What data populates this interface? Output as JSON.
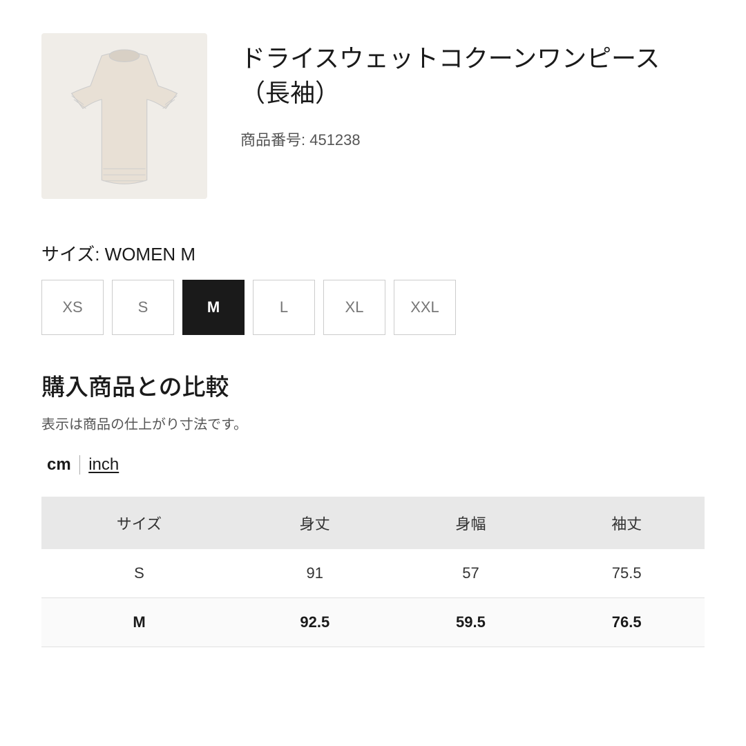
{
  "product": {
    "name": "ドライスウェットコクーンワンピース（長袖）",
    "number_label": "商品番号: 451238",
    "image_alt": "cream cocoon dress"
  },
  "size_section": {
    "label": "サイズ: WOMEN M",
    "sizes": [
      "XS",
      "S",
      "M",
      "L",
      "XL",
      "XXL"
    ],
    "active_size": "M"
  },
  "comparison": {
    "title": "購入商品との比較",
    "subtitle": "表示は商品の仕上がり寸法です。",
    "unit_cm": "cm",
    "unit_inch": "inch"
  },
  "table": {
    "headers": [
      "サイズ",
      "身丈",
      "身幅",
      "袖丈"
    ],
    "rows": [
      {
        "size": "S",
        "body_length": "91",
        "body_width": "57",
        "sleeve_length": "75.5",
        "highlighted": false
      },
      {
        "size": "M",
        "body_length": "92.5",
        "body_width": "59.5",
        "sleeve_length": "76.5",
        "highlighted": true
      }
    ]
  }
}
